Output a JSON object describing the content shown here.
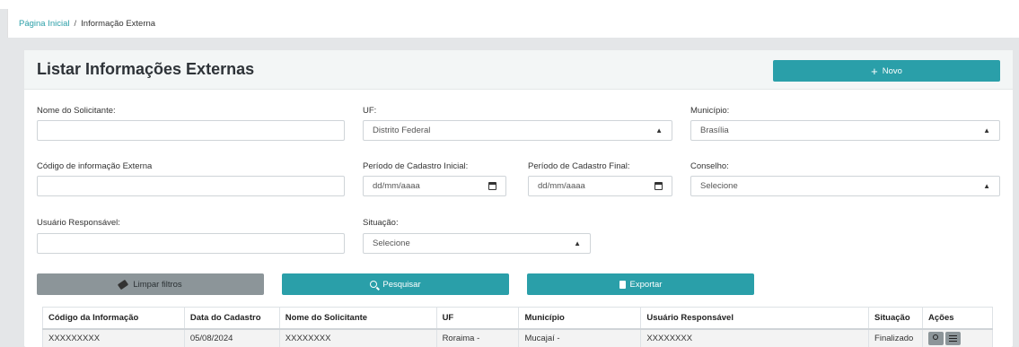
{
  "breadcrumb": {
    "home": "Página Inicial",
    "separator": "/",
    "current": "Informação Externa"
  },
  "page": {
    "title": "Listar Informações Externas",
    "new_label": "Novo"
  },
  "filters": {
    "nome_label": "Nome do Solicitante:",
    "nome_value": "",
    "uf_label": "UF:",
    "uf_value": "Distrito Federal",
    "municipio_label": "Município:",
    "municipio_value": "Brasília",
    "codigo_label": "Código de informação Externa",
    "codigo_value": "",
    "periodo_ini_label": "Período de Cadastro Inicial:",
    "periodo_ini_value": "dd/mm/aaaa",
    "periodo_fim_label": "Período de Cadastro Final:",
    "periodo_fim_value": "dd/mm/aaaa",
    "conselho_label": "Conselho:",
    "conselho_value": "Selecione",
    "usuario_label": "Usuário Responsável:",
    "usuario_value": "",
    "situacao_label": "Situação:",
    "situacao_value": "Selecione"
  },
  "actions": {
    "clear_label": "Limpar filtros",
    "search_label": "Pesquisar",
    "export_label": "Exportar"
  },
  "table": {
    "headers": [
      "Código da Informação",
      "Data do Cadastro",
      "Nome do Solicitante",
      "UF",
      "Município",
      "Usuário Responsável",
      "Situação",
      "Ações"
    ],
    "rows": [
      [
        "XXXXXXXXX",
        "05/08/2024",
        "XXXXXXXX",
        "Roraima -",
        "Mucajaí -",
        "XXXXXXXX",
        "Finalizado"
      ]
    ]
  },
  "colors": {
    "accent": "#2a9fa9",
    "secondary": "#8c9599",
    "link": "#2b9fa8"
  }
}
